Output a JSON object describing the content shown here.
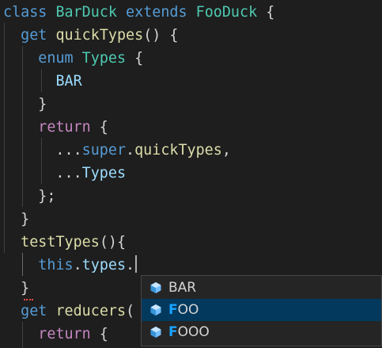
{
  "editor": {
    "lines": [
      [
        [
          "kw",
          "class"
        ],
        [
          "pun",
          " "
        ],
        [
          "cls",
          "BarDuck"
        ],
        [
          "pun",
          " "
        ],
        [
          "kw",
          "extends"
        ],
        [
          "pun",
          " "
        ],
        [
          "cls",
          "FooDuck"
        ],
        [
          "pun",
          " {"
        ]
      ],
      [
        [
          "pun",
          "  "
        ],
        [
          "kw",
          "get"
        ],
        [
          "pun",
          " "
        ],
        [
          "fn",
          "quickTypes"
        ],
        [
          "pun",
          "() {"
        ]
      ],
      [
        [
          "pun",
          "    "
        ],
        [
          "kw",
          "enum"
        ],
        [
          "pun",
          " "
        ],
        [
          "cls",
          "Types"
        ],
        [
          "pun",
          " {"
        ]
      ],
      [
        [
          "pun",
          "      "
        ],
        [
          "prop",
          "BAR"
        ]
      ],
      [
        [
          "pun",
          "    }"
        ]
      ],
      [
        [
          "pun",
          "    "
        ],
        [
          "ctrl",
          "return"
        ],
        [
          "pun",
          " {"
        ]
      ],
      [
        [
          "pun",
          "      ..."
        ],
        [
          "kw",
          "super"
        ],
        [
          "pun",
          "."
        ],
        [
          "fn",
          "quickTypes"
        ],
        [
          "pun",
          ","
        ]
      ],
      [
        [
          "pun",
          "      ..."
        ],
        [
          "prop",
          "Types"
        ]
      ],
      [
        [
          "pun",
          "    };"
        ]
      ],
      [
        [
          "pun",
          "  }"
        ]
      ],
      [
        [
          "pun",
          "  "
        ],
        [
          "fn",
          "testTypes"
        ],
        [
          "pun",
          "(){"
        ]
      ],
      [
        [
          "pun",
          "    "
        ],
        [
          "kw",
          "this"
        ],
        [
          "pun",
          "."
        ],
        [
          "prop",
          "types"
        ],
        [
          "pun",
          "."
        ]
      ],
      [
        [
          "pun",
          "  }"
        ]
      ],
      [
        [
          "pun",
          "  "
        ],
        [
          "kw",
          "get"
        ],
        [
          "pun",
          " "
        ],
        [
          "fn",
          "reducers"
        ],
        [
          "pun",
          "("
        ]
      ],
      [
        [
          "pun",
          "    "
        ],
        [
          "ctrl",
          "return"
        ],
        [
          "pun",
          " {"
        ]
      ]
    ]
  },
  "suggest": {
    "items": [
      {
        "match": "",
        "rest": "BAR",
        "selected": false
      },
      {
        "match": "F",
        "rest": "OO",
        "selected": true
      },
      {
        "match": "F",
        "rest": "OOO",
        "selected": false
      }
    ],
    "icon": "enum-member-icon",
    "icon_color": "#75beff"
  }
}
